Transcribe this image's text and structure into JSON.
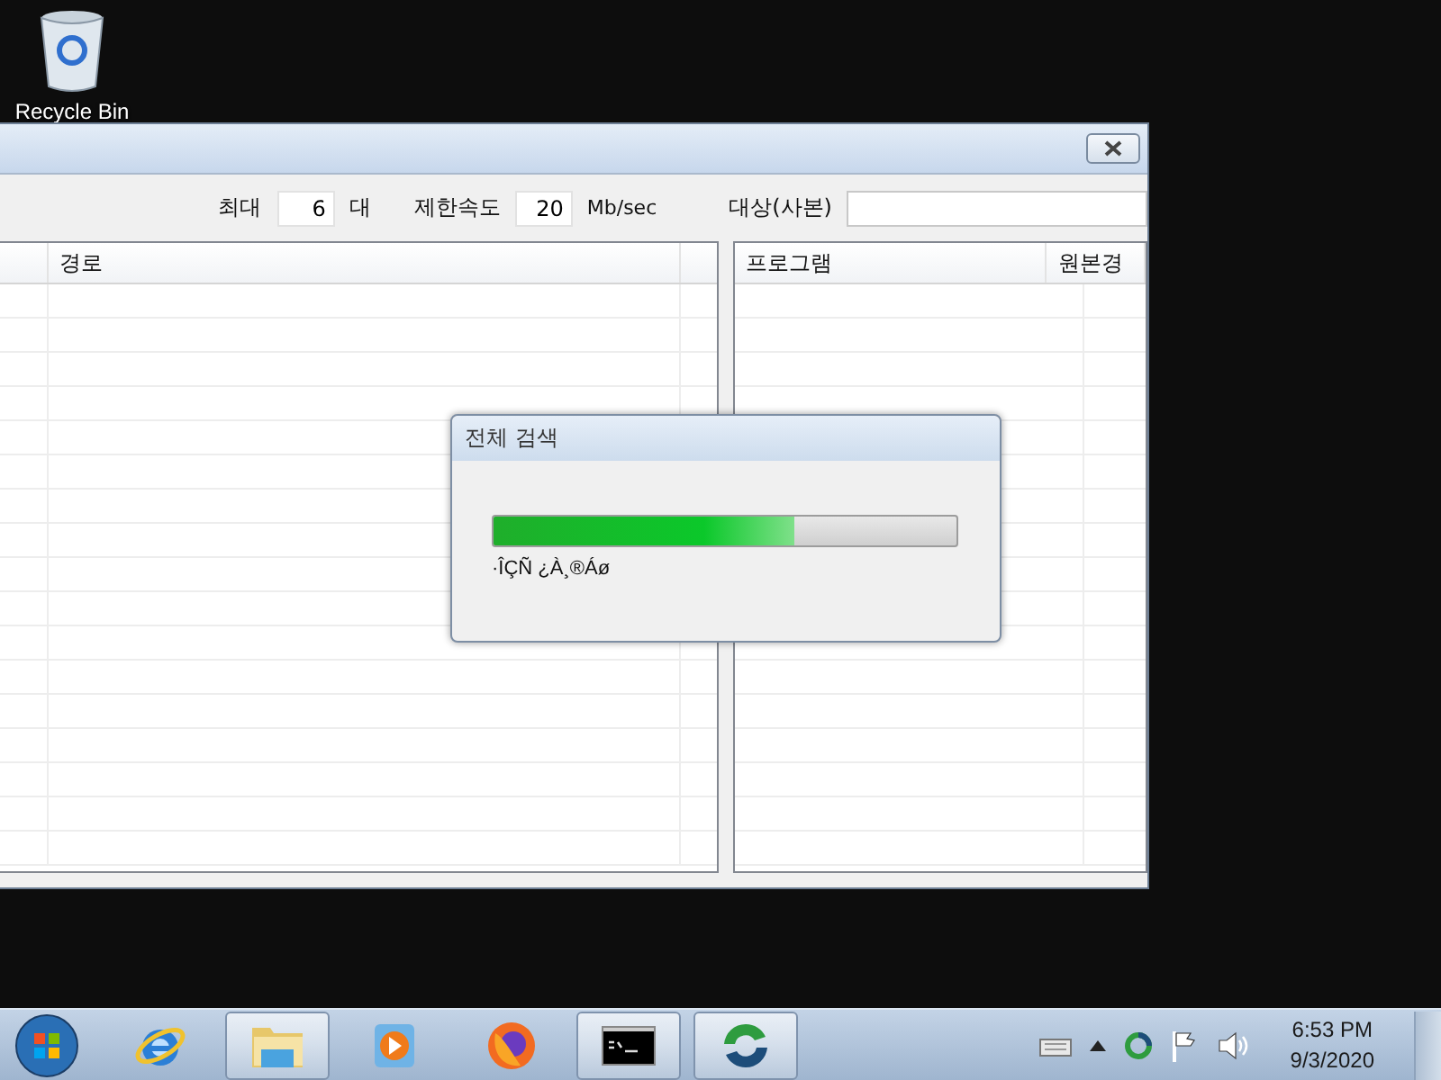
{
  "desktop": {
    "icons": [
      {
        "kind": "recycle-bin",
        "label": "Recycle Bin"
      }
    ]
  },
  "window": {
    "toolbar": {
      "max_label": "최대",
      "max_value": "6",
      "max_unit": "대",
      "speed_label": "제한속도",
      "speed_value": "20",
      "speed_unit": "Mb/sec",
      "target_label": "대상(사본)"
    },
    "left_table": {
      "columns": [
        "경로"
      ]
    },
    "right_table": {
      "columns": [
        "프로그램",
        "원본경"
      ]
    }
  },
  "dialog": {
    "title": "전체 검색",
    "progress": {
      "level": 0.65
    },
    "status": "·ÎÇÑ ¿À¸®Áø"
  },
  "taskbar": {
    "items": [
      {
        "kind": "browser-e",
        "running": false
      },
      {
        "kind": "folders",
        "running": true
      },
      {
        "kind": "media",
        "running": false
      },
      {
        "kind": "fox",
        "running": false
      },
      {
        "kind": "console",
        "running": true
      },
      {
        "kind": "swirl",
        "running": true
      }
    ],
    "tray": {
      "time": "6:53 PM",
      "date": "9/3/2020"
    }
  }
}
